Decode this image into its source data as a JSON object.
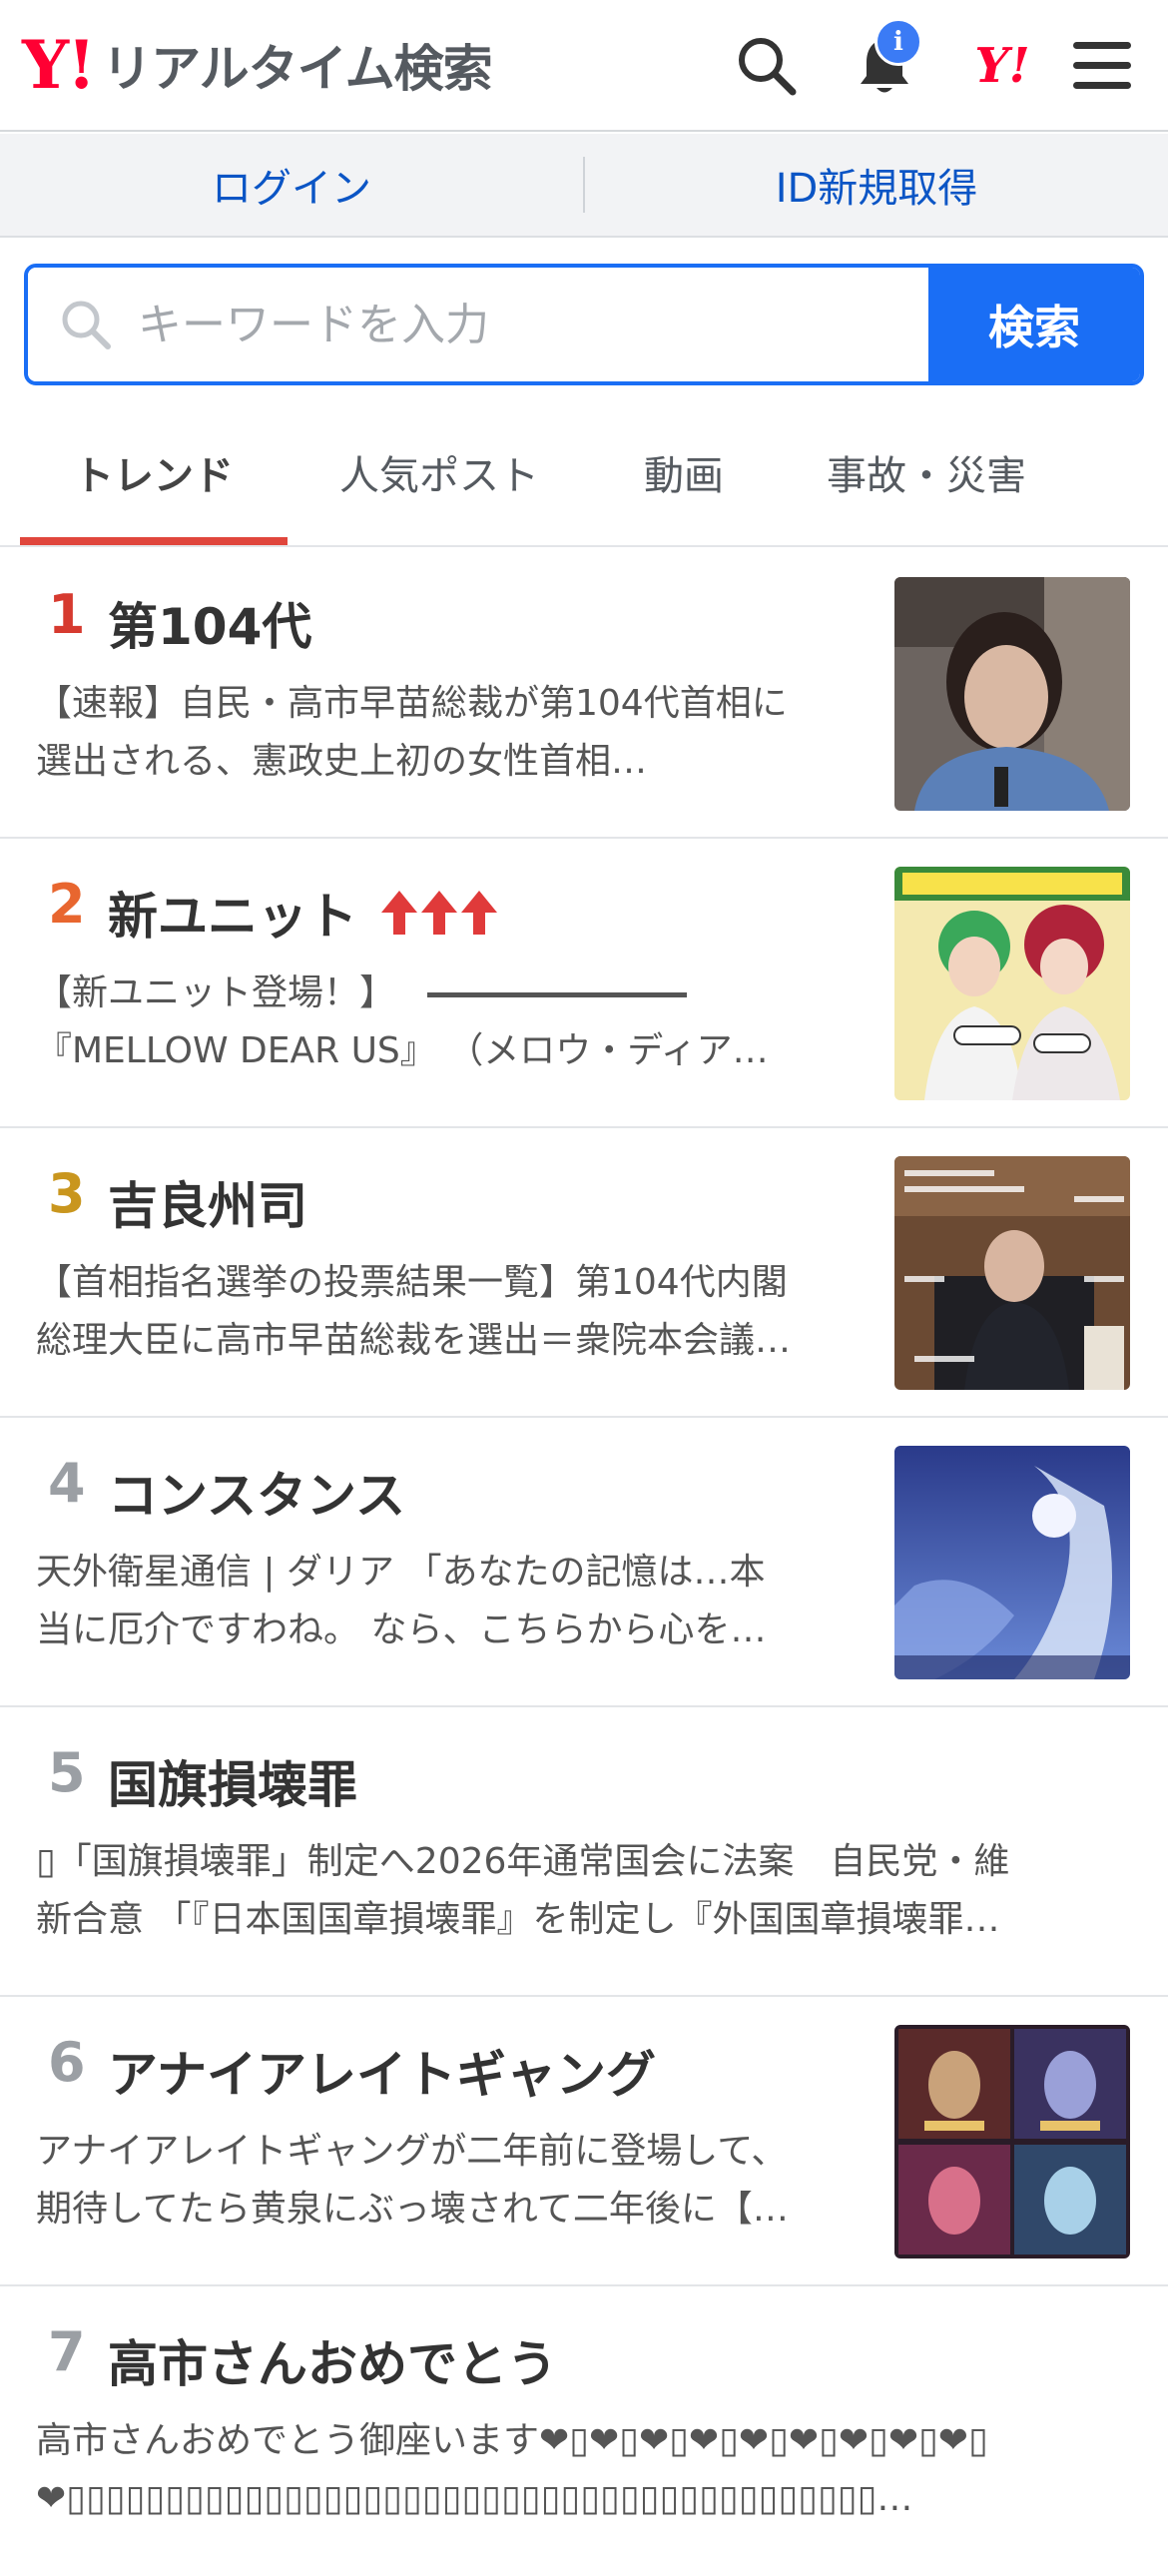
{
  "header": {
    "logo_y": "Y!",
    "logo_text": "リアルタイム検索",
    "badge": "i",
    "ylogo": "Y!"
  },
  "auth": {
    "login": "ログイン",
    "register": "ID新規取得"
  },
  "search": {
    "placeholder": "キーワードを入力",
    "button": "検索"
  },
  "tabs": [
    "トレンド",
    "人気ポスト",
    "動画",
    "事故・災害"
  ],
  "colors": {
    "brand_red": "#ff0033",
    "accent_blue": "#1a6ef5",
    "tab_underline": "#e0463c",
    "rank_1": "#d63a2f",
    "rank_2": "#e8662f",
    "rank_3": "#c9961e",
    "rank_other": "#9b9fa4",
    "trend_arrow": "#e03a3a"
  },
  "trends": [
    {
      "rank": "1",
      "title": "第104代",
      "desc1": "【速報】自民・高市早苗総裁が第104代首相に",
      "desc2": "選出される、憲政史上初の女性首相…",
      "thumb": "portrait-photo"
    },
    {
      "rank": "2",
      "title": "新ユニット",
      "rising": true,
      "desc1": "【新ユニット登場！】",
      "desc2": "『MELLOW DEAR US』 （メロウ・ディア…",
      "thumb": "anime-illustration"
    },
    {
      "rank": "3",
      "title": "吉良州司",
      "desc1": "【首相指名選挙の投票結果一覧】第104代内閣",
      "desc2": "総理大臣に高市早苗総裁を選出＝衆院本会議…",
      "thumb": "video-still"
    },
    {
      "rank": "4",
      "title": "コンスタンス",
      "desc1": "天外衛星通信 | ダリア 「あなたの記憶は…本",
      "desc2": "当に厄介ですわね。 なら、こちらから心を…",
      "thumb": "game-art"
    },
    {
      "rank": "5",
      "title": "国旗損壊罪",
      "desc1": "▯「国旗損壊罪」制定へ2026年通常国会に法案　自民党・維",
      "desc2": "新合意 「『日本国国章損壊罪』を制定し『外国国章損壊罪…",
      "thumb": ""
    },
    {
      "rank": "6",
      "title": "アナイアレイトギャング",
      "desc1": "アナイアレイトギャングが二年前に登場して、",
      "desc2": "期待してたら黄泉にぶっ壊されて二年後に【…",
      "thumb": "game-cards"
    },
    {
      "rank": "7",
      "title": "高市さんおめでとう",
      "desc1": "高市さんおめでとう御座います❤▯❤▯❤▯❤▯❤▯❤▯❤▯❤▯❤▯",
      "desc2": "❤▯▯▯▯▯▯▯▯▯▯▯▯▯▯▯▯▯▯▯▯▯▯▯▯▯▯▯▯▯▯▯▯▯▯▯▯▯▯▯▯▯…",
      "thumb": ""
    }
  ]
}
